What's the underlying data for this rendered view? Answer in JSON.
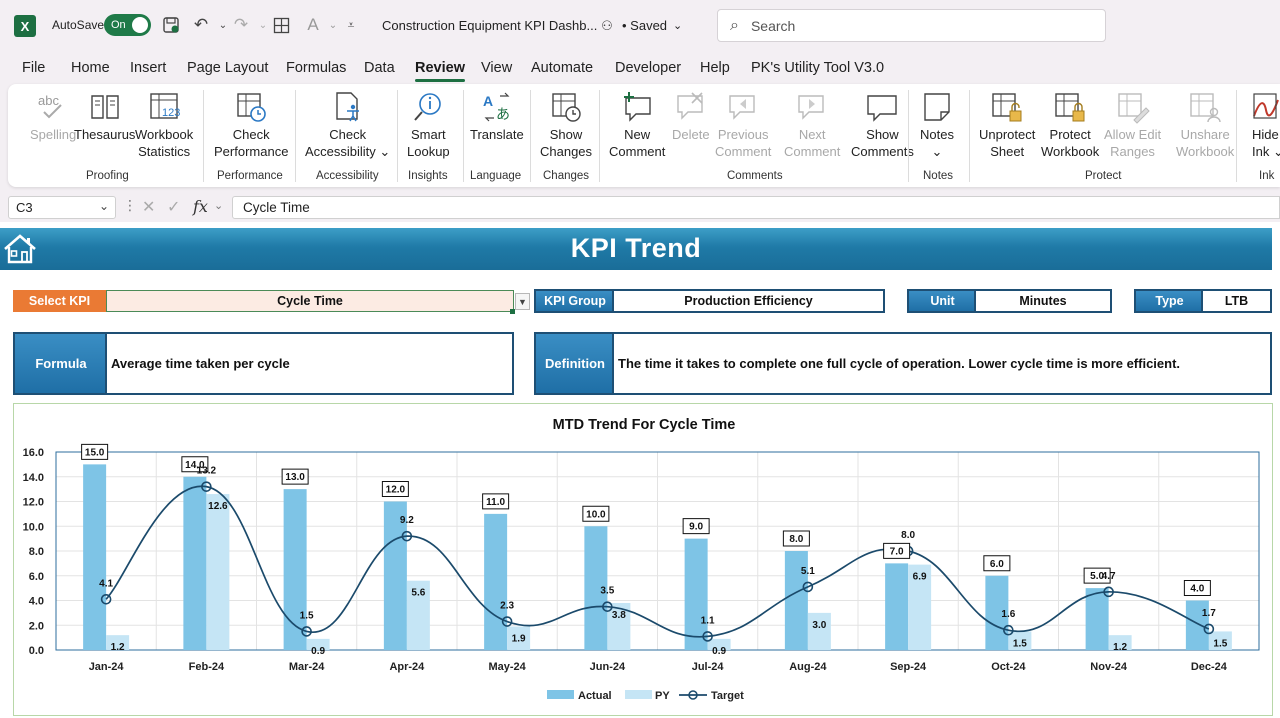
{
  "titlebar": {
    "autosave_label": "AutoSave",
    "autosave_state": "On",
    "doc_title": "Construction Equipment KPI Dashb...",
    "saved_label": "• Saved",
    "search_placeholder": "Search"
  },
  "menu": {
    "tabs": [
      "File",
      "Home",
      "Insert",
      "Page Layout",
      "Formulas",
      "Data",
      "Review",
      "View",
      "Automate",
      "Developer",
      "Help",
      "PK's Utility Tool V3.0"
    ],
    "active": "Review"
  },
  "ribbon": {
    "buttons": {
      "spelling": "Spelling",
      "thesaurus": "Thesaurus",
      "workbook_statistics_1": "Workbook",
      "workbook_statistics_2": "Statistics",
      "check_performance_1": "Check",
      "check_performance_2": "Performance",
      "check_accessibility_1": "Check",
      "check_accessibility_2": "Accessibility",
      "smart_lookup_1": "Smart",
      "smart_lookup_2": "Lookup",
      "translate": "Translate",
      "show_changes_1": "Show",
      "show_changes_2": "Changes",
      "new_comment_1": "New",
      "new_comment_2": "Comment",
      "delete": "Delete",
      "previous_comment_1": "Previous",
      "previous_comment_2": "Comment",
      "next_comment_1": "Next",
      "next_comment_2": "Comment",
      "show_comments_1": "Show",
      "show_comments_2": "Comments",
      "notes": "Notes",
      "unprotect_sheet_1": "Unprotect",
      "unprotect_sheet_2": "Sheet",
      "protect_workbook_1": "Protect",
      "protect_workbook_2": "Workbook",
      "allow_edit_ranges_1": "Allow Edit",
      "allow_edit_ranges_2": "Ranges",
      "unshare_workbook_1": "Unshare",
      "unshare_workbook_2": "Workbook",
      "hide_ink_1": "Hide",
      "hide_ink_2": "Ink"
    },
    "groups": {
      "proofing": "Proofing",
      "performance": "Performance",
      "accessibility": "Accessibility",
      "insights": "Insights",
      "language": "Language",
      "changes": "Changes",
      "comments": "Comments",
      "notes": "Notes",
      "protect": "Protect",
      "ink": "Ink"
    }
  },
  "formula_bar": {
    "name_box": "C3",
    "fx": "fx",
    "content": "Cycle Time"
  },
  "dashboard": {
    "title": "KPI Trend",
    "select_kpi_label": "Select KPI",
    "select_kpi_value": "Cycle Time",
    "kpi_group_label": "KPI Group",
    "kpi_group_value": "Production Efficiency",
    "unit_label": "Unit",
    "unit_value": "Minutes",
    "type_label": "Type",
    "type_value": "LTB",
    "formula_label": "Formula",
    "formula_value": "Average time taken per cycle",
    "definition_label": "Definition",
    "definition_value": "The time it takes to complete one full cycle of operation. Lower cycle time is more efficient."
  },
  "colors": {
    "actual": "#7ec4e6",
    "py": "#c5e5f5",
    "target": "#1b4a6b",
    "banner": "#1f7aa7",
    "select_label": "#ea7a34",
    "excel_green": "#1d6f42"
  },
  "chart_data": {
    "type": "bar",
    "title": "MTD Trend For Cycle Time",
    "categories": [
      "Jan-24",
      "Feb-24",
      "Mar-24",
      "Apr-24",
      "May-24",
      "Jun-24",
      "Jul-24",
      "Aug-24",
      "Sep-24",
      "Oct-24",
      "Nov-24",
      "Dec-24"
    ],
    "series": [
      {
        "name": "Actual",
        "type": "bar",
        "values": [
          15.0,
          14.0,
          13.0,
          12.0,
          11.0,
          10.0,
          9.0,
          8.0,
          7.0,
          6.0,
          5.0,
          4.0
        ]
      },
      {
        "name": "PY",
        "type": "bar",
        "values": [
          1.2,
          12.6,
          0.9,
          5.6,
          1.9,
          3.8,
          0.9,
          3.0,
          6.9,
          1.5,
          1.2,
          1.5
        ]
      },
      {
        "name": "Target",
        "type": "line",
        "smooth": true,
        "values": [
          4.1,
          13.2,
          1.5,
          9.2,
          2.3,
          3.5,
          1.1,
          5.1,
          8.0,
          1.6,
          4.7,
          1.7
        ]
      }
    ],
    "ylim": [
      0,
      16
    ],
    "yticks": [
      "0.0",
      "2.0",
      "4.0",
      "6.0",
      "8.0",
      "10.0",
      "12.0",
      "14.0",
      "16.0"
    ],
    "grid": true,
    "legend": "bottom"
  }
}
